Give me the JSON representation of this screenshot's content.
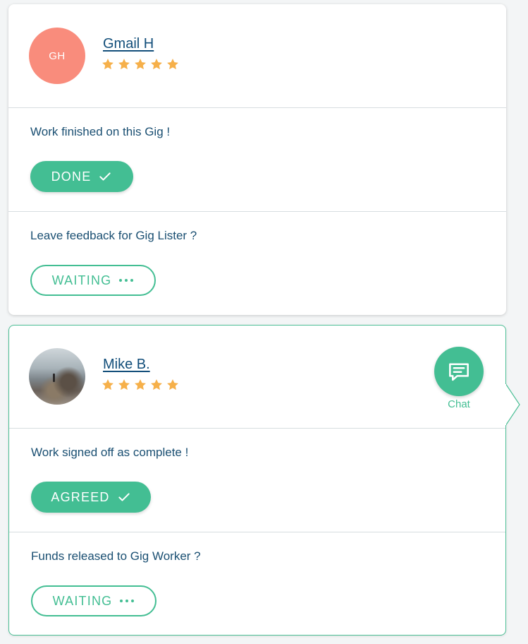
{
  "cards": [
    {
      "avatar_initials": "GH",
      "name": "Gmail H",
      "rating": 5,
      "step1": {
        "label": "Work finished on this Gig !",
        "button": "DONE"
      },
      "step2": {
        "label": "Leave feedback for Gig Lister ?",
        "button": "WAITING"
      }
    },
    {
      "name": "Mike B.",
      "rating": 5,
      "chat_label": "Chat",
      "step1": {
        "label": "Work signed off as complete !",
        "button": "AGREED"
      },
      "step2": {
        "label": "Funds released to Gig Worker ?",
        "button": "WAITING"
      }
    }
  ],
  "icons": {
    "star": "star-icon",
    "done": "check-icon",
    "waiting": "ellipsis-icon",
    "chat": "chat-bubble-icon"
  },
  "colors": {
    "accent": "#43be93",
    "star": "#f6b04a",
    "avatar": "#f98c7c",
    "name": "#124e7a"
  }
}
